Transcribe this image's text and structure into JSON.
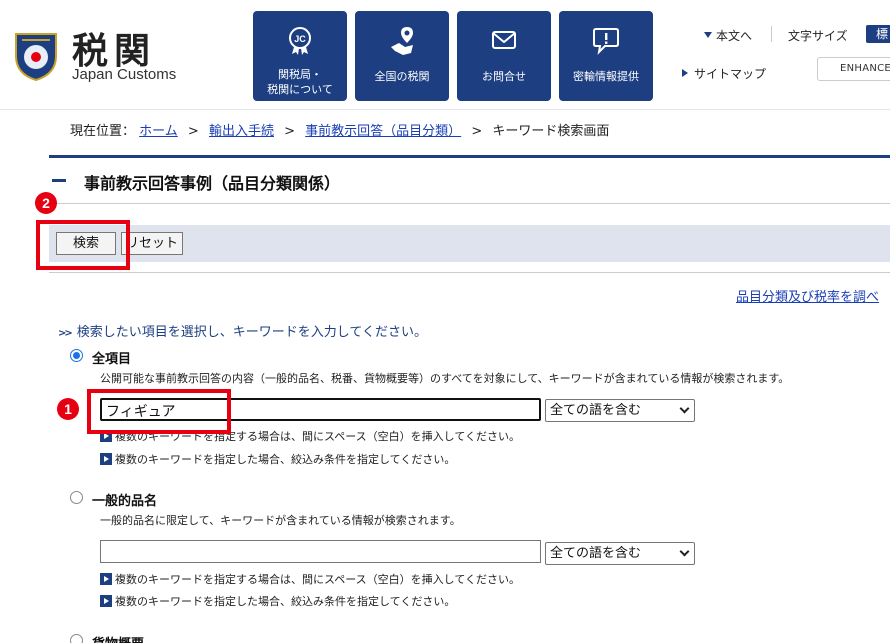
{
  "header": {
    "brand_main": "税関",
    "brand_sub": "Japan Customs",
    "nav": [
      {
        "label_line1": "関税局・",
        "label_line2": "税関について"
      },
      {
        "label": "全国の税関"
      },
      {
        "label": "お問合せ"
      },
      {
        "label": "密輸情報提供"
      }
    ],
    "skip_link": "本文へ",
    "font_size_label": "文字サイズ",
    "font_size_std": "標",
    "sitemap": "サイトマップ",
    "search_placeholder": "ENHANCED"
  },
  "breadcrumb": {
    "prefix": "現在位置：",
    "items": [
      "ホーム",
      "輸出入手続",
      "事前教示回答（品目分類）"
    ],
    "current": "キーワード検索画面",
    "separator": ">"
  },
  "page_title": "事前教示回答事例（品目分類関係）",
  "toolbar": {
    "search_label": "検索",
    "reset_label": "リセット"
  },
  "right_link": "品目分類及び税率を調べ",
  "instruction": "検索したい項目を選択し、キーワードを入力してください。",
  "sections": [
    {
      "label": "全項目",
      "checked": true,
      "description": "公開可能な事前教示回答の内容（一般的品名、税番、貨物概要等）のすべてを対象にして、キーワードが含まれている情報が検索されます。",
      "input_value": "フィギュア",
      "select_value": "全ての語を含む",
      "notes": [
        "複数のキーワードを指定する場合は、間にスペース（空白）を挿入してください。",
        "複数のキーワードを指定した場合、絞込み条件を指定してください。"
      ]
    },
    {
      "label": "一般的品名",
      "checked": false,
      "description": "一般的品名に限定して、キーワードが含まれている情報が検索されます。",
      "input_value": "",
      "select_value": "全ての語を含む",
      "notes": [
        "複数のキーワードを指定する場合は、間にスペース（空白）を挿入してください。",
        "複数のキーワードを指定した場合、絞込み条件を指定してください。"
      ]
    },
    {
      "label": "貨物概要",
      "checked": false
    }
  ],
  "annotations": {
    "badge1": "1",
    "badge2": "2"
  },
  "colors": {
    "brand": "#1d3f82",
    "highlight": "#e60012",
    "link": "#1a3fb5"
  }
}
